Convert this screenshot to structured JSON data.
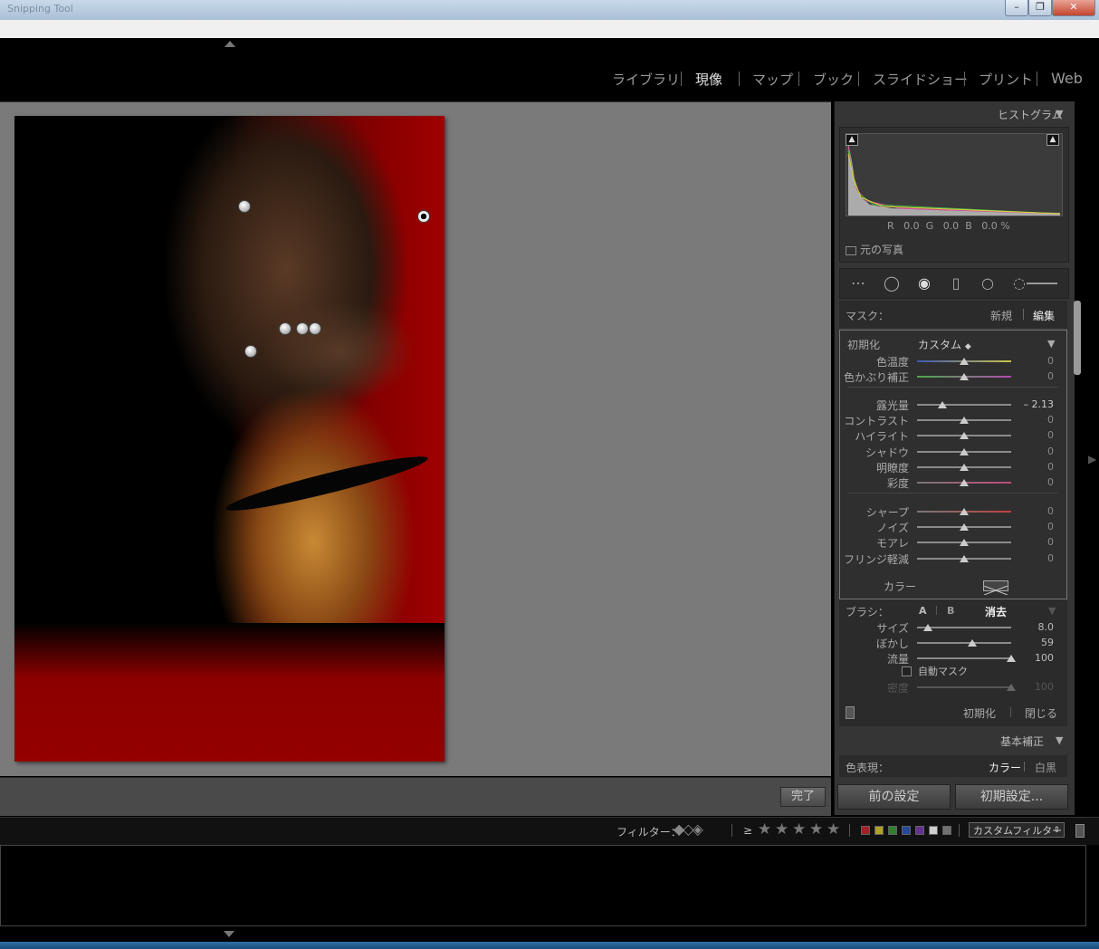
{
  "window": {
    "title": "Snipping Tool",
    "controls": {
      "minimize": "–",
      "maximize": "❐",
      "close": "✕"
    }
  },
  "modules": [
    {
      "label": "ライブラリ",
      "active": false
    },
    {
      "label": "現像",
      "active": true
    },
    {
      "label": "マップ",
      "active": false
    },
    {
      "label": "ブック",
      "active": false
    },
    {
      "label": "スライドショー",
      "active": false
    },
    {
      "label": "プリント",
      "active": false
    },
    {
      "label": "Web",
      "active": false
    }
  ],
  "histogram": {
    "title": "ヒストグラム",
    "r_label": "R",
    "r_value": "0.0",
    "g_label": "G",
    "g_value": "0.0",
    "b_label": "B",
    "b_value": "0.0",
    "unit": "%",
    "original_photo": "元の写真"
  },
  "mask": {
    "label": "マスク：",
    "new": "新規",
    "edit": "編集"
  },
  "adjust": {
    "reset_label": "初期化",
    "preset": "カスタム",
    "preset_arrow": "◆",
    "color_label": "カラー",
    "groups": [
      [
        {
          "label": "色温度",
          "value": "0",
          "pos": 0.5
        },
        {
          "label": "色かぶり補正",
          "value": "0",
          "pos": 0.5
        }
      ],
      [
        {
          "label": "露光量",
          "value": "– 2.13",
          "pos": 0.27
        },
        {
          "label": "コントラスト",
          "value": "0",
          "pos": 0.5
        },
        {
          "label": "ハイライト",
          "value": "0",
          "pos": 0.5
        },
        {
          "label": "シャドウ",
          "value": "0",
          "pos": 0.5
        },
        {
          "label": "明瞭度",
          "value": "0",
          "pos": 0.5
        },
        {
          "label": "彩度",
          "value": "0",
          "pos": 0.5
        }
      ],
      [
        {
          "label": "シャープ",
          "value": "0",
          "pos": 0.5
        },
        {
          "label": "ノイズ",
          "value": "0",
          "pos": 0.5
        },
        {
          "label": "モアレ",
          "value": "0",
          "pos": 0.5
        },
        {
          "label": "フリンジ軽減",
          "value": "0",
          "pos": 0.5
        }
      ]
    ]
  },
  "brush": {
    "label": "ブラシ：",
    "a": "A",
    "b": "B",
    "erase": "消去",
    "sliders": [
      {
        "label": "サイズ",
        "value": "8.0",
        "pos": 0.12
      },
      {
        "label": "ぼかし",
        "value": "59",
        "pos": 0.59
      },
      {
        "label": "流量",
        "value": "100",
        "pos": 1.0
      }
    ],
    "auto_mask": "自動マスク",
    "density": {
      "label": "密度",
      "value": "100",
      "pos": 1.0
    },
    "reset": "初期化",
    "close": "閉じる"
  },
  "basic": {
    "title": "基本補正",
    "treatment_label": "色表現：",
    "color": "カラー",
    "bw": "白黒"
  },
  "buttons": {
    "previous": "前の設定",
    "reset": "初期設定...",
    "done": "完了"
  },
  "filter": {
    "label": "フィルター：",
    "ge": "≥",
    "stars": "★",
    "custom": "カスタムフィルター",
    "colors": [
      "#c0282a",
      "#d6c52a",
      "#3a9a3a",
      "#2a56c0",
      "#7a3ab0",
      "#ffffff",
      "#888888"
    ]
  }
}
